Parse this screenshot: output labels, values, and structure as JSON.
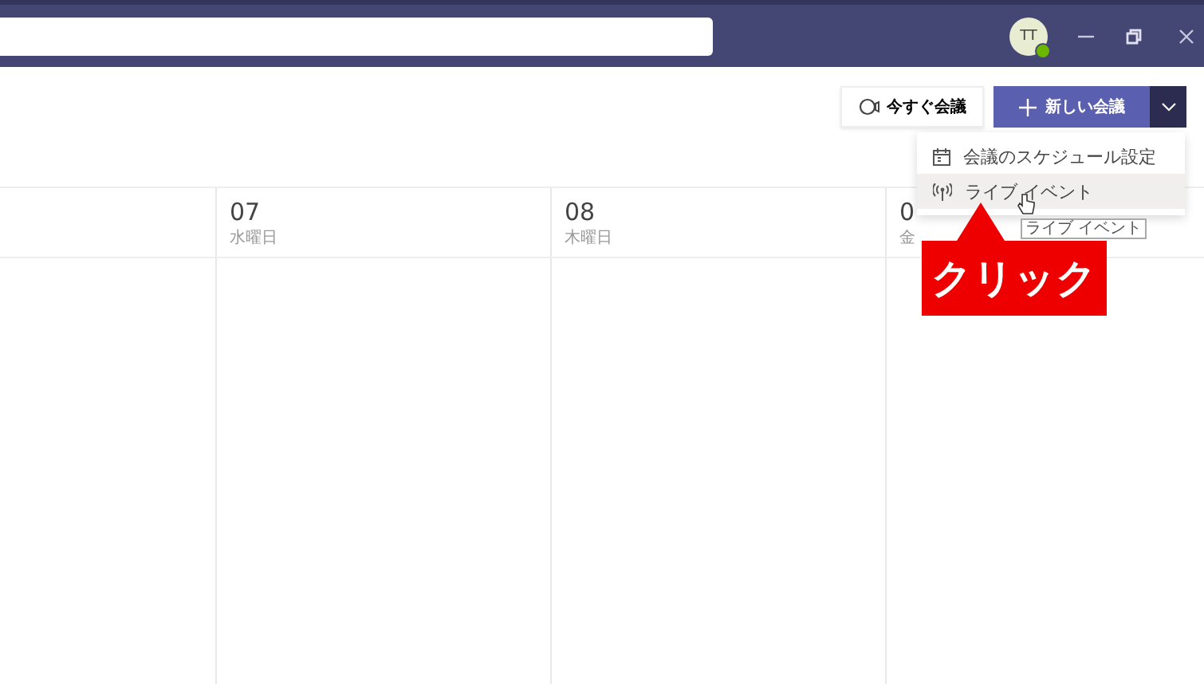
{
  "title_bar": {
    "avatar": "TT",
    "presence_online": true
  },
  "toolbar": {
    "meet_now": "今すぐ会議",
    "new_meeting": "新しい会議"
  },
  "days": [
    {
      "number": "07",
      "weekday": "水曜日"
    },
    {
      "number": "08",
      "weekday": "木曜日"
    },
    {
      "number": "0",
      "weekday": "金"
    }
  ],
  "menu": {
    "items": [
      {
        "kind": "calendar",
        "label": "会議のスケジュール設定",
        "selected": false
      },
      {
        "kind": "broadcast",
        "label": "ライブ イベント",
        "selected": true
      }
    ]
  },
  "tooltip": "ライブ イベント",
  "callout": "クリック"
}
